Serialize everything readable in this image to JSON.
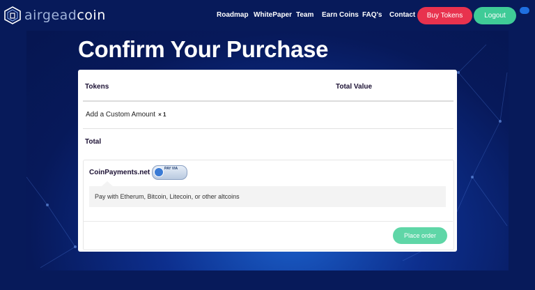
{
  "brand": {
    "name_light": "airgead",
    "name_bold": "coin",
    "logo_icon": "hex-logo-icon"
  },
  "nav": {
    "links": [
      "Roadmap",
      "WhitePaper",
      "Team",
      "Earn Coins",
      "FAQ's",
      "Contact"
    ],
    "buy_label": "Buy Tokens",
    "logout_label": "Logout"
  },
  "page": {
    "title": "Confirm Your Purchase"
  },
  "order": {
    "col_tokens": "Tokens",
    "col_total_value": "Total Value",
    "item_name": "Add a Custom Amount",
    "item_qty": "× 1",
    "total_label": "Total"
  },
  "payment": {
    "method_label": "CoinPayments.net",
    "badge_text": "PAY VIA",
    "description": "Pay with Etherum, Bitcoin, Litecoin, or other altcoins",
    "place_order_label": "Place order"
  },
  "colors": {
    "buy": "#e8324e",
    "logout": "#3fcb97",
    "place_order": "#5fd6a7",
    "bg": "#071a5a"
  }
}
